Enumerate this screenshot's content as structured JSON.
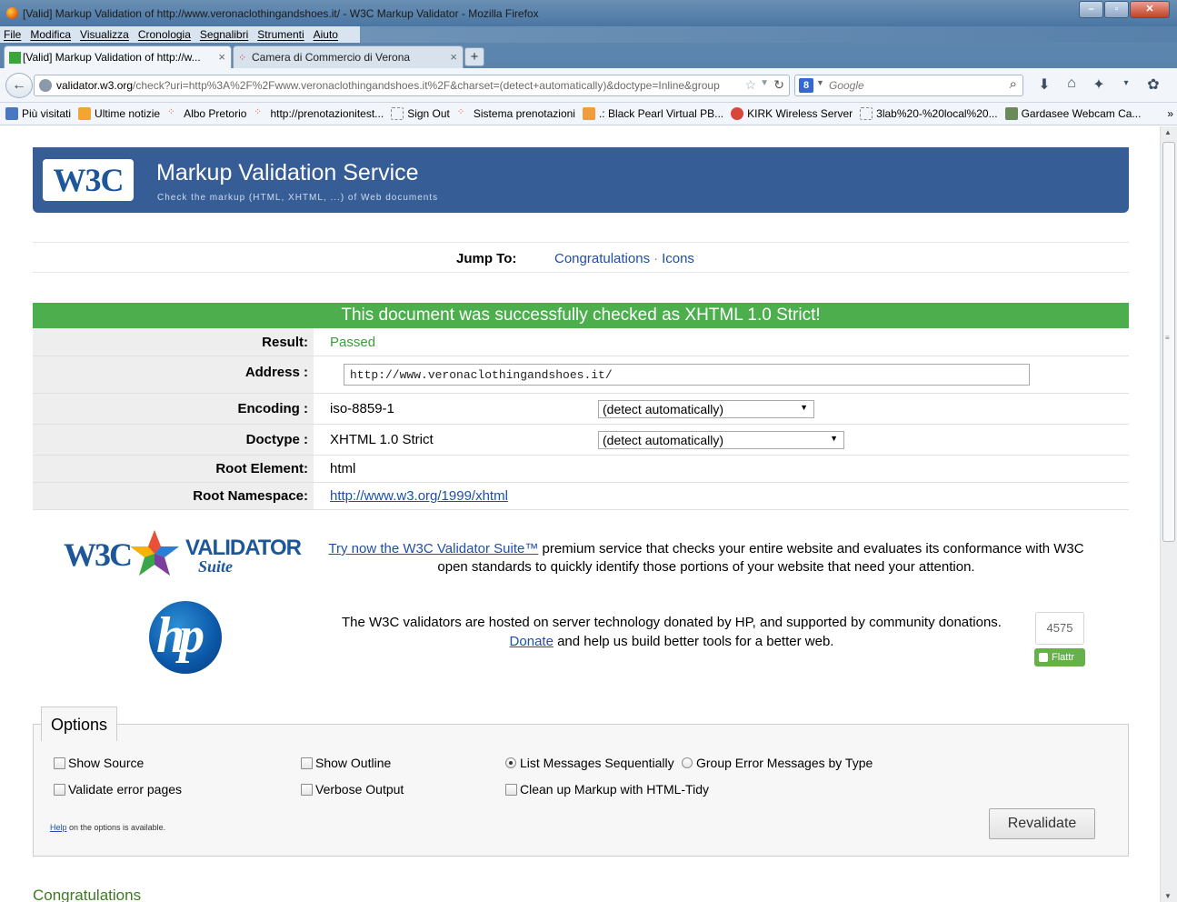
{
  "window": {
    "title": "[Valid] Markup Validation of http://www.veronaclothingandshoes.it/ - W3C Markup Validator - Mozilla Firefox",
    "min": "–",
    "max": "▫",
    "close": "✕"
  },
  "menu": [
    "File",
    "Modifica",
    "Visualizza",
    "Cronologia",
    "Segnalibri",
    "Strumenti",
    "Aiuto"
  ],
  "tabs": [
    {
      "label": "[Valid] Markup Validation of http://w...",
      "close": "×"
    },
    {
      "label": "Camera di Commercio di Verona",
      "close": "×"
    }
  ],
  "new_tab": "+",
  "nav": {
    "back": "←",
    "url_domain": "validator.w3.org",
    "url_rest": "/check?uri=http%3A%2F%2Fwww.veronaclothingandshoes.it%2F&charset=(detect+automatically)&doctype=Inline&group",
    "search_placeholder": "Google",
    "search_engine": "8",
    "icons": [
      "download-icon",
      "home-icon",
      "addon-icon",
      "menu-dropdown-icon",
      "bird-icon"
    ]
  },
  "bookmarks": [
    {
      "label": "Più visitati",
      "color": "#4a78c0"
    },
    {
      "label": "Ultime notizie",
      "color": "#f2a531"
    },
    {
      "label": "Albo Pretorio",
      "color": "#e04a4a"
    },
    {
      "label": "http://prenotazionitest...",
      "color": "#e04a4a"
    },
    {
      "label": "Sign Out",
      "color": "#ffffff"
    },
    {
      "label": "Sistema prenotazioni",
      "color": "#e04a4a"
    },
    {
      "label": ".: Black Pearl Virtual PB...",
      "color": "#f29b3c"
    },
    {
      "label": "KIRK Wireless Server",
      "color": "#d9463a"
    },
    {
      "label": "3lab%20-%20local%20...",
      "color": "#ffffff"
    },
    {
      "label": "Gardasee Webcam Ca...",
      "color": "#6a8a5a"
    }
  ],
  "bookmarks_more": "»",
  "banner": {
    "logo": "W3C",
    "title": "Markup Validation Service",
    "subtitle": "Check the markup (HTML, XHTML, ...) of Web documents"
  },
  "jump": {
    "label": "Jump To:",
    "links": [
      "Congratulations",
      "Icons"
    ],
    "sep": "·"
  },
  "result": {
    "banner": "This document was successfully checked as XHTML 1.0 Strict!",
    "rows": {
      "result": {
        "key": "Result:",
        "value": "Passed"
      },
      "address": {
        "key": "Address :",
        "value": "http://www.veronaclothingandshoes.it/"
      },
      "encoding": {
        "key": "Encoding :",
        "value": "iso-8859-1",
        "select": "(detect automatically)"
      },
      "doctype": {
        "key": "Doctype :",
        "value": "XHTML 1.0 Strict",
        "select": "(detect automatically)"
      },
      "root_element": {
        "key": "Root Element:",
        "value": "html"
      },
      "root_namespace": {
        "key": "Root Namespace:",
        "value": "http://www.w3.org/1999/xhtml"
      }
    },
    "success_color": "#4cae4c"
  },
  "suite": {
    "logo_w3c": "W3C",
    "logo_validator": "VALIDATOR",
    "logo_suite": "Suite",
    "link": "Try now the W3C Validator Suite™",
    "text": " premium service that checks your entire website and evaluates its conformance with W3C open standards to quickly identify those portions of your website that need your attention."
  },
  "hosting": {
    "hp_logo": "hp",
    "text1": "The W3C validators are hosted on server technology donated by HP, and supported by community donations.",
    "donate": "Donate",
    "text2": " and help us build better tools for a better web.",
    "flattr_count": "4575",
    "flattr_label": "Flattr"
  },
  "options": {
    "legend": "Options",
    "show_source": "Show Source",
    "show_outline": "Show Outline",
    "list_sequential": "List Messages Sequentially",
    "group_by_type": "Group Error Messages by Type",
    "validate_error_pages": "Validate error pages",
    "verbose_output": "Verbose Output",
    "cleanup_tidy": "Clean up Markup with HTML-Tidy",
    "help_link": "Help",
    "help_text": " on the options is available.",
    "revalidate": "Revalidate"
  },
  "congratulations_heading": "Congratulations"
}
